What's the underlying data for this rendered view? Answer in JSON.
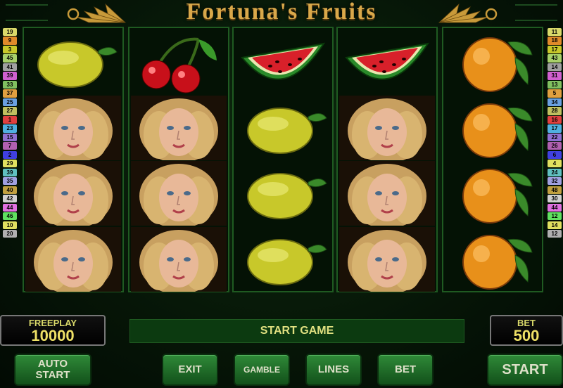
{
  "game": {
    "title": "Fortuna's Fruits"
  },
  "lines_left": [
    "19",
    "9",
    "3",
    "45",
    "41",
    "39",
    "33",
    "37",
    "25",
    "27",
    "1",
    "23",
    "15",
    "7",
    "2",
    "29",
    "39",
    "35",
    "40",
    "42",
    "44",
    "46",
    "10",
    "20"
  ],
  "lines_right": [
    "11",
    "18",
    "17",
    "43",
    "14",
    "31",
    "13",
    "5",
    "34",
    "28",
    "16",
    "17",
    "22",
    "26",
    "6",
    "4",
    "24",
    "32",
    "48",
    "30",
    "44",
    "12",
    "14",
    "12"
  ],
  "line_colors": [
    "#d9d96a",
    "#e08a2a",
    "#c8c82a",
    "#a8d06a",
    "#a0a0a0",
    "#d060d0",
    "#80c060",
    "#e0a040",
    "#6aa0e0",
    "#c0c060",
    "#e04040",
    "#50b0e0",
    "#9070d0",
    "#b060b0",
    "#4040e0",
    "#e0e060",
    "#60c0c0",
    "#a0a0e0",
    "#c0a040",
    "#d0d0d0",
    "#e070e0",
    "#60e060",
    "#e0e060",
    "#b0b0b0"
  ],
  "reels": [
    [
      "lemon",
      "woman",
      "woman",
      "woman"
    ],
    [
      "cherries",
      "woman",
      "woman",
      "woman"
    ],
    [
      "watermelon",
      "lemon",
      "lemon",
      "lemon"
    ],
    [
      "watermelon",
      "woman",
      "woman",
      "woman"
    ],
    [
      "orange",
      "orange",
      "orange",
      "orange"
    ]
  ],
  "freeplay": {
    "label": "FREEPLAY",
    "value": "10000"
  },
  "bet": {
    "label": "BET",
    "value": "500"
  },
  "message": "START GAME",
  "buttons": {
    "auto_start_line1": "AUTO",
    "auto_start_line2": "START",
    "exit": "EXIT",
    "gamble": "GAMBLE",
    "lines": "LINES",
    "bet": "BET",
    "start": "START"
  }
}
